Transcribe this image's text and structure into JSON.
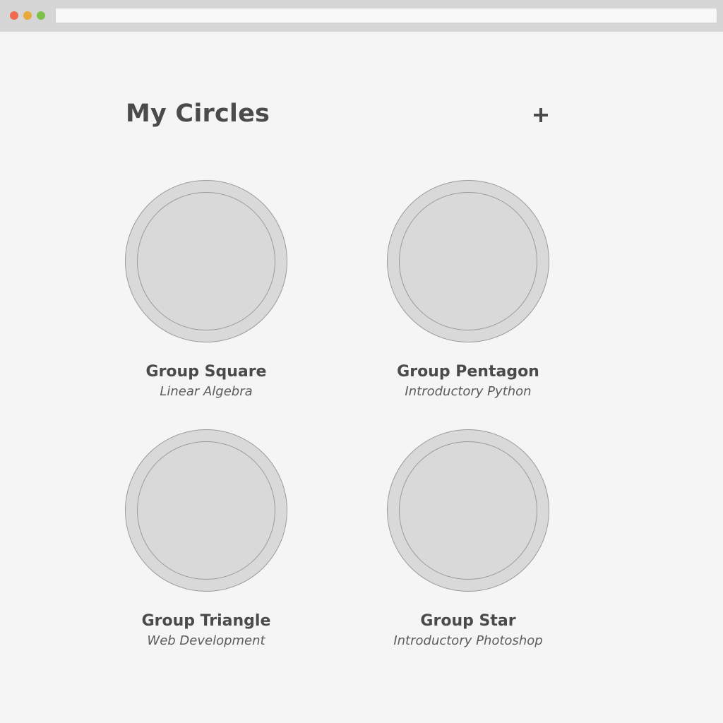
{
  "header": {
    "title": "My Circles",
    "add_icon": "plus-icon"
  },
  "groups": [
    {
      "name": "Group Square",
      "subject": "Linear Algebra"
    },
    {
      "name": "Group Pentagon",
      "subject": "Introductory Python"
    },
    {
      "name": "Group Triangle",
      "subject": "Web Development"
    },
    {
      "name": "Group Star",
      "subject": "Introductory Photoshop"
    }
  ],
  "colors": {
    "traffic_red": "#ef6a4f",
    "traffic_yellow": "#e9a93a",
    "traffic_green": "#7cc24a",
    "avatar_fill": "#d9d9d9",
    "text": "#4a4a4a"
  }
}
